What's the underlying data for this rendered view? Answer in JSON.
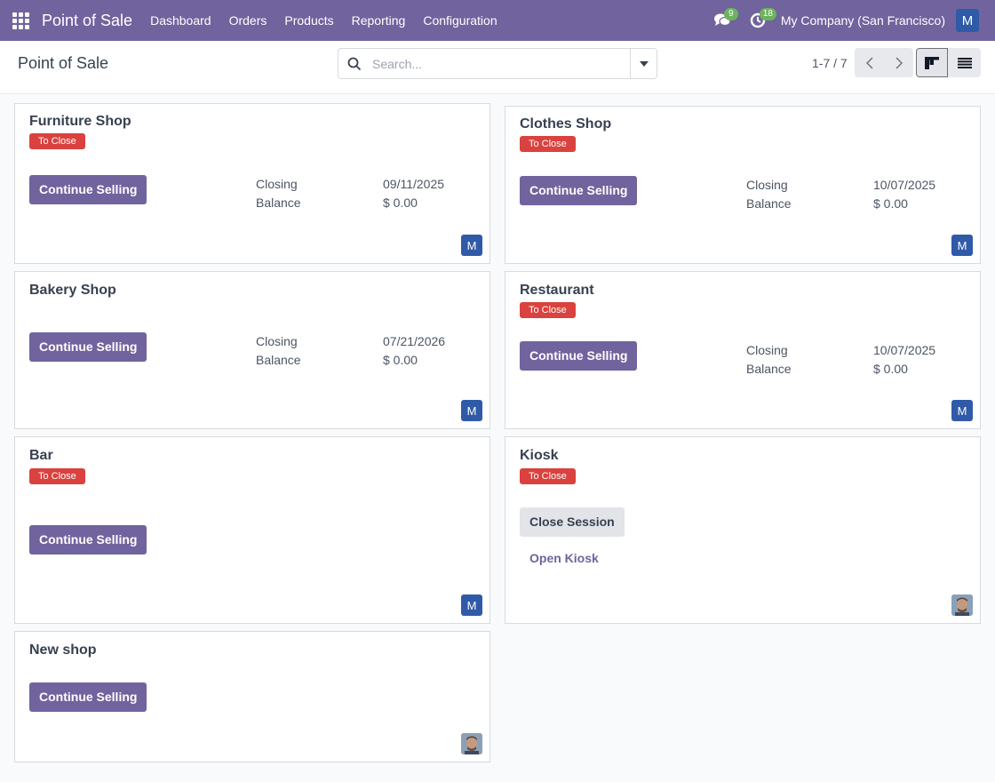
{
  "navbar": {
    "brand": "Point of Sale",
    "menu": [
      "Dashboard",
      "Orders",
      "Products",
      "Reporting",
      "Configuration"
    ],
    "messages_count": "9",
    "activities_count": "18",
    "company": "My Company (San Francisco)",
    "user_initial": "M",
    "accent_color": "#71639e"
  },
  "control_panel": {
    "title": "Point of Sale",
    "search_placeholder": "Search...",
    "pager": "1-7 / 7"
  },
  "labels": {
    "to_close": "To Close",
    "continue_selling": "Continue Selling",
    "close_session": "Close Session",
    "open_kiosk": "Open Kiosk",
    "closing": "Closing",
    "balance": "Balance"
  },
  "cards": [
    {
      "name": "Furniture Shop",
      "to_close": true,
      "closing_date": "09/11/2025",
      "balance": "$ 0.00",
      "avatar": "M"
    },
    {
      "name": "Clothes Shop",
      "to_close": true,
      "closing_date": "10/07/2025",
      "balance": "$ 0.00",
      "avatar": "M"
    },
    {
      "name": "Bakery Shop",
      "to_close": false,
      "closing_date": "07/21/2026",
      "balance": "$ 0.00",
      "avatar": "M"
    },
    {
      "name": "Restaurant",
      "to_close": true,
      "closing_date": "10/07/2025",
      "balance": "$ 0.00",
      "avatar": "M"
    },
    {
      "name": "Bar",
      "to_close": true,
      "avatar": "M"
    },
    {
      "name": "Kiosk",
      "to_close": true,
      "avatar": "photo"
    },
    {
      "name": "New shop",
      "to_close": false,
      "avatar": "photo"
    }
  ]
}
